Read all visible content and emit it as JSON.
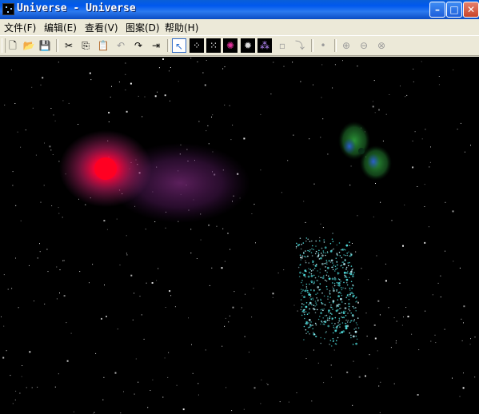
{
  "window": {
    "title": "Universe - Universe"
  },
  "menu": [
    {
      "label": "文件(F)"
    },
    {
      "label": "编辑(E)"
    },
    {
      "label": "查看(V)"
    },
    {
      "label": "图案(D)"
    },
    {
      "label": "帮助(H)"
    }
  ],
  "toolbar": {
    "tools": [
      {
        "icon": "new-icon",
        "glyph": "🗋",
        "enabled": true
      },
      {
        "icon": "open-icon",
        "glyph": "📂",
        "enabled": true
      },
      {
        "icon": "save-icon",
        "glyph": "💾",
        "enabled": true
      },
      {
        "icon": "cut-icon",
        "glyph": "✂",
        "enabled": true
      },
      {
        "icon": "copy-icon",
        "glyph": "⎘",
        "enabled": true
      },
      {
        "icon": "paste-icon",
        "glyph": "📋",
        "enabled": false
      },
      {
        "icon": "undo-icon",
        "glyph": "↶",
        "enabled": false
      },
      {
        "icon": "redo-icon",
        "glyph": "↷",
        "enabled": true
      },
      {
        "icon": "export-icon",
        "glyph": "⇥",
        "enabled": true
      },
      {
        "icon": "select-arrow-icon",
        "glyph": "↖",
        "enabled": true,
        "selected": true
      },
      {
        "icon": "starfield-icon",
        "glyph": "⁘",
        "enabled": true
      },
      {
        "icon": "dense-stars-icon",
        "glyph": "⁙",
        "enabled": true
      },
      {
        "icon": "red-nebula-icon",
        "glyph": "✺",
        "enabled": true
      },
      {
        "icon": "galaxy-icon",
        "glyph": "✹",
        "enabled": true
      },
      {
        "icon": "cluster-icon",
        "glyph": "⁂",
        "enabled": true
      },
      {
        "icon": "blank-tool-icon",
        "glyph": "▫",
        "enabled": false
      },
      {
        "icon": "rotate-tool-icon",
        "glyph": "⤵",
        "enabled": false
      },
      {
        "icon": "point-tool-icon",
        "glyph": "•",
        "enabled": false
      },
      {
        "icon": "zoom-in-icon",
        "glyph": "⊕",
        "enabled": false
      },
      {
        "icon": "zoom-out-icon",
        "glyph": "⊖",
        "enabled": false
      },
      {
        "icon": "target-icon",
        "glyph": "⊗",
        "enabled": false
      }
    ]
  },
  "colors": {
    "titlebar": "#0058EE",
    "canvas": "#000000",
    "chrome": "#ECE9D8",
    "nebula": "#FF0022",
    "galaxy": "#2E9E3A",
    "cluster": "#4FE0E0"
  }
}
